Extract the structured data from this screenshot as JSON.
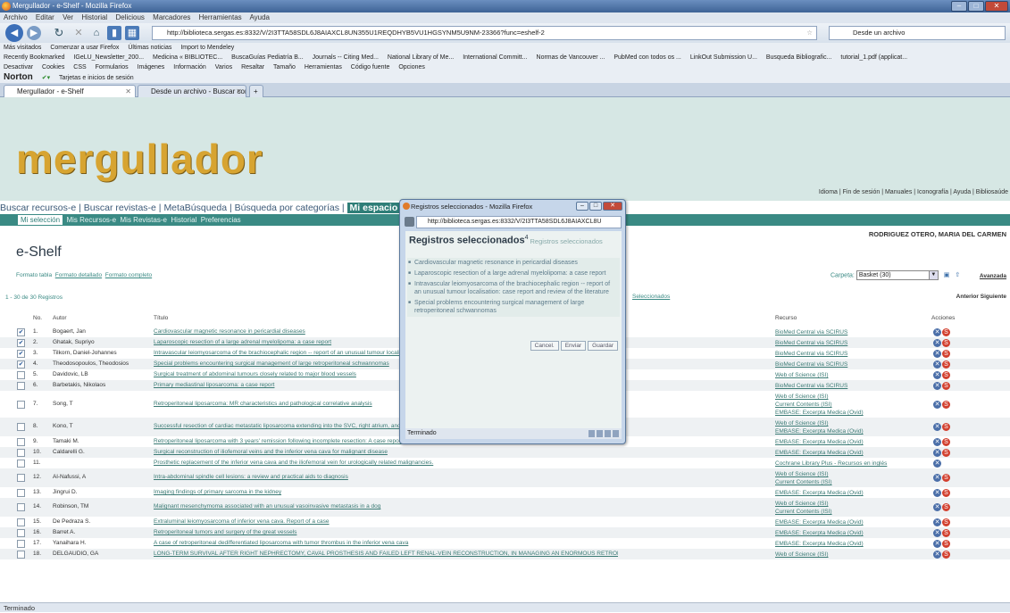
{
  "window": {
    "title": "Mergullador - e-Shelf - Mozilla Firefox"
  },
  "menubar": [
    "Archivo",
    "Editar",
    "Ver",
    "Historial",
    "Delicious",
    "Marcadores",
    "Herramientas",
    "Ayuda"
  ],
  "navbar": {
    "url": "http://biblioteca.sergas.es:8332/V/2I3TTA58SDL6J8AIAXCL8UN355U1REQDHYB5VU1HGSYNM5U9NM-23366?func=eshelf-2",
    "search_placeholder": "Desde un archivo"
  },
  "bookmarks": [
    "Más visitados",
    "Comenzar a usar Firefox",
    "Últimas noticias",
    "Import to Mendeley"
  ],
  "toolbar2": [
    "Recently Bookmarked",
    "IGeLU_Newsletter_200...",
    "Medicina « BIBLIOTEC...",
    "BuscaGuías Pediatría B...",
    "Journals -- Citing Med...",
    "National Library of Me...",
    "International Committ...",
    "Normas de Vancouver ...",
    "PubMed con todos os ...",
    "LinkOut Submission U...",
    "Busqueda Bibliografic...",
    "tutorial_1.pdf (applicat..."
  ],
  "toolbar3": [
    "Desactivar",
    "Cookies",
    "CSS",
    "Formularios",
    "Imágenes",
    "Información",
    "Varios",
    "Resaltar",
    "Tamaño",
    "Herramientas",
    "Código fuente",
    "Opciones"
  ],
  "toolbar4": {
    "brand": "Norton",
    "item": "Tarjetas e inicios de sesión"
  },
  "tabs": [
    "Mergullador - e-Shelf",
    "Desde un archivo - Buscar con Goo..."
  ],
  "site": {
    "logo": "mergullador",
    "toplinks": "Idioma | Fin de sesión | Manuales | Iconografía | Ayuda | Bibliosaúde",
    "mainnav": [
      "Buscar recursos-e",
      "Buscar revistas-e",
      "MetaBúsqueda",
      "Búsqueda por categorías",
      "Mi espacio"
    ],
    "subnav": [
      "Mi selección",
      "Mis Recursos-e",
      "Mis Revistas-e",
      "Historial",
      "Preferencias"
    ],
    "username": "RODRIGUEZ OTERO, MARIA DEL CARMEN",
    "page_title": "e-Shelf",
    "formats": {
      "tabla": "Formato tabla",
      "detallado": "Formato detallado",
      "completo": "Formato completo"
    },
    "carpeta_label": "Carpeta:",
    "carpeta_value": "Basket (30)",
    "avanzada": "Avanzada",
    "results_text": "1 - 30 de 30 Registros",
    "seleccionados": "Seleccionados",
    "pager": "Anterior  Siguiente",
    "columns": {
      "no": "No.",
      "autor": "Autor",
      "titulo": "Título",
      "recurso": "Recurso",
      "acciones": "Acciones"
    }
  },
  "rows": [
    {
      "no": "1.",
      "checked": true,
      "author": "Bogaert, Jan",
      "title": "Cardiovascular magnetic resonance in pericardial diseases",
      "resource": [
        "BioMed Central via SCIRUS"
      ]
    },
    {
      "no": "2.",
      "checked": true,
      "author": "Ghatak, Supriyo",
      "title": "Laparoscopic resection of a large adrenal myelolipoma: a case report",
      "resource": [
        "BioMed Central via SCIRUS"
      ]
    },
    {
      "no": "3.",
      "checked": true,
      "author": "Tilkorn, Daniel-Johannes",
      "title": "Intravascular leiomyosarcoma of the brachiocephalic region -- report of an unusual tumour locali",
      "resource": [
        "BioMed Central via SCIRUS"
      ]
    },
    {
      "no": "4.",
      "checked": true,
      "author": "Theodosopoulos, Theodosios",
      "title": "Special problems encountering surgical management of large retroperitoneal schwannomas",
      "resource": [
        "BioMed Central via SCIRUS"
      ]
    },
    {
      "no": "5.",
      "checked": false,
      "author": "Davidovic, LB",
      "title": "Surgical treatment of abdominal tumours closely related to major blood vessels",
      "resource": [
        "Web of Science (ISI)"
      ]
    },
    {
      "no": "6.",
      "checked": false,
      "author": "Barbetakis, Nikolaos",
      "title": "Primary mediastinal liposarcoma: a case report",
      "resource": [
        "BioMed Central via SCIRUS"
      ]
    },
    {
      "no": "7.",
      "checked": false,
      "author": "Song, T",
      "title": "Retroperitoneal liposarcoma: MR characteristics and pathological correlative analysis",
      "resource": [
        "Web of Science (ISI)",
        "Current Contents (ISI)",
        "EMBASE: Excerpta Medica (Ovid)"
      ]
    },
    {
      "no": "8.",
      "checked": false,
      "author": "Kono, T",
      "title": "Successful resection of cardiac metastatic liposarcoma extending into the SVC, right atrium, and right ventricle",
      "resource": [
        "Web of Science (ISI)",
        "EMBASE: Excerpta Medica (Ovid)"
      ]
    },
    {
      "no": "9.",
      "checked": false,
      "author": "Tamaki M.",
      "title": "Retroperitoneal liposarcoma with 3 years' remission following incomplete resection: A case report",
      "resource": [
        "EMBASE: Excerpta Medica (Ovid)"
      ]
    },
    {
      "no": "10.",
      "checked": false,
      "author": "Caldarelli G.",
      "title": "Surgical reconstruction of iliofemoral veins and the inferior vena cava for malignant disease",
      "resource": [
        "EMBASE: Excerpta Medica (Ovid)"
      ]
    },
    {
      "no": "11.",
      "checked": false,
      "author": "",
      "title": "Prosthetic replacement of the inferior vena cava and the iliofemoral vein for urologically related malignancies.",
      "resource": [
        "Cochrane Library Plus - Recursos en inglés"
      ]
    },
    {
      "no": "12.",
      "checked": false,
      "author": "Al-Nafussi, A",
      "title": "Intra-abdominal spindle cell lesions: a review and practical aids to diagnosis",
      "resource": [
        "Web of Science (ISI)",
        "Current Contents (ISI)"
      ]
    },
    {
      "no": "13.",
      "checked": false,
      "author": "Jingrui D.",
      "title": "Imaging findings of primary sarcoma in the kidney",
      "resource": [
        "EMBASE: Excerpta Medica (Ovid)"
      ]
    },
    {
      "no": "14.",
      "checked": false,
      "author": "Robinson, TM",
      "title": "Malignant mesenchymoma associated with an unusual vasoinvasive metastasis in a dog",
      "resource": [
        "Web of Science (ISI)",
        "Current Contents (ISI)"
      ]
    },
    {
      "no": "15.",
      "checked": false,
      "author": "De Pedraza S.",
      "title": "Extraluminal leiomyosarcoma of inferior vena cava. Report of a case",
      "resource": [
        "EMBASE: Excerpta Medica (Ovid)"
      ]
    },
    {
      "no": "16.",
      "checked": false,
      "author": "Barret A.",
      "title": "Retroperitoneal tumors and surgery of the great vessels",
      "resource": [
        "EMBASE: Excerpta Medica (Ovid)"
      ]
    },
    {
      "no": "17.",
      "checked": false,
      "author": "Yanaihara H.",
      "title": "A case of retroperitoneal dedifferentiated liposarcoma with tumor thrombus in the inferior vena cava",
      "resource": [
        "EMBASE: Excerpta Medica (Ovid)"
      ]
    },
    {
      "no": "18.",
      "checked": false,
      "author": "DELGAUDIO, GA",
      "title": "LONG-TERM SURVIVAL AFTER RIGHT NEPHRECTOMY, CAVAL PROSTHESIS AND FAILED LEFT RENAL-VEIN RECONSTRUCTION, IN MANAGING AN ENORMOUS RETROPERITONEAL TUMOR",
      "resource": [
        "Web of Science (ISI)"
      ]
    }
  ],
  "popup": {
    "title": "Registros seleccionados - Mozilla Firefox",
    "url": "http://biblioteca.sergas.es:8332/V/2I3TTA58SDL6J8AIAXCL8U",
    "heading": "Registros seleccionados",
    "count": "4",
    "subheading": "Registros seleccionados",
    "items": [
      "Cardiovascular magnetic resonance in pericardial diseases",
      "Laparoscopic resection of a large adrenal myelolipoma: a case report",
      "Intravascular leiomyosarcoma of the brachiocephalic region -- report of an unusual tumour localisation: case report and review of the literature",
      "Special problems encountering surgical management of large retroperitoneal schwannomas"
    ],
    "buttons": {
      "cancel": "Cancel.",
      "send": "Enviar",
      "save": "Guardar"
    },
    "status": "Terminado"
  },
  "statusbar": "Terminado"
}
